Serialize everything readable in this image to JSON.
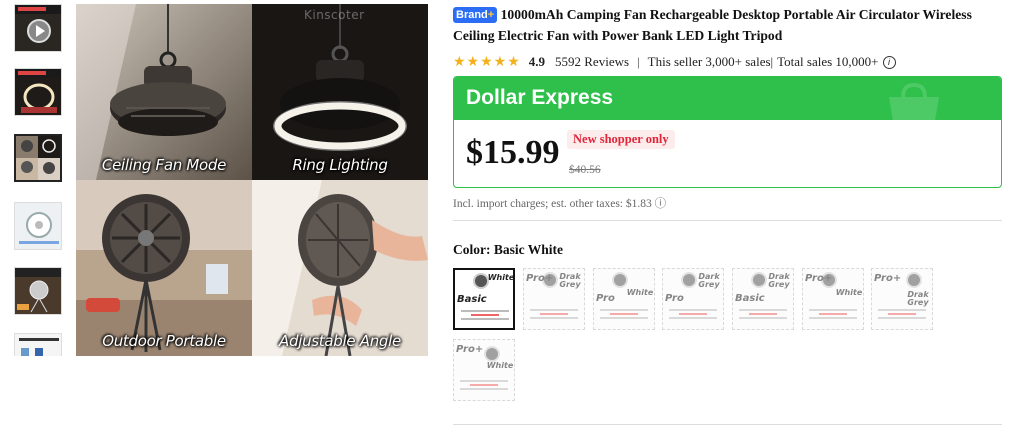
{
  "gallery": {
    "thumbnails": [
      {
        "name": "thumbnail-1",
        "theme": "dark-video"
      },
      {
        "name": "thumbnail-2",
        "theme": "dark-ring"
      },
      {
        "name": "thumbnail-3",
        "theme": "collage"
      },
      {
        "name": "thumbnail-4",
        "theme": "white-fan"
      },
      {
        "name": "thumbnail-5",
        "theme": "tripod"
      },
      {
        "name": "thumbnail-6",
        "theme": "diagram"
      }
    ],
    "selected_index": 2,
    "main_image": {
      "watermark": "Kinscoter",
      "panels": [
        {
          "caption": "Ceiling Fan Mode"
        },
        {
          "caption": "Ring Lighting"
        },
        {
          "caption": "Outdoor Portable"
        },
        {
          "caption": "Adjustable Angle"
        }
      ]
    }
  },
  "product": {
    "brand_badge": "Brand",
    "brand_badge_plus": "+",
    "title": "10000mAh Camping Fan Rechargeable Desktop Portable Air Circulator Wireless Ceiling Electric Fan with Power Bank LED Light Tripod",
    "stars": "★★★★★",
    "rating": "4.9",
    "reviews": "5592 Reviews",
    "separator": "|",
    "seller_sales": "This seller 3,000+ sales|",
    "total_sales": "Total sales 10,000+",
    "info_icon": "i"
  },
  "deal": {
    "title": "Dollar Express",
    "price": "$15.99",
    "badge": "New shopper only",
    "original_price": "$40.56",
    "tax_note": "Incl. import charges; est. other taxes: $1.83 ⓘ",
    "accent": "#2ec04a",
    "badge_color": "#e0263a"
  },
  "color_selector": {
    "label": "Color: Basic White",
    "options": [
      {
        "variant": "Basic",
        "color": "White",
        "selected": true
      },
      {
        "variant": "Pro+",
        "color": "Drak Grey",
        "selected": false
      },
      {
        "variant": "Pro",
        "color": "White",
        "selected": false
      },
      {
        "variant": "Pro",
        "color": "Dark Grey",
        "selected": false
      },
      {
        "variant": "Basic",
        "color": "Drak Grey",
        "selected": false
      },
      {
        "variant": "Pro+",
        "color": "White",
        "selected": false
      },
      {
        "variant": "Pro+",
        "color": "Drak Grey",
        "selected": false
      },
      {
        "variant": "Pro+",
        "color": "White",
        "selected": false
      }
    ]
  }
}
